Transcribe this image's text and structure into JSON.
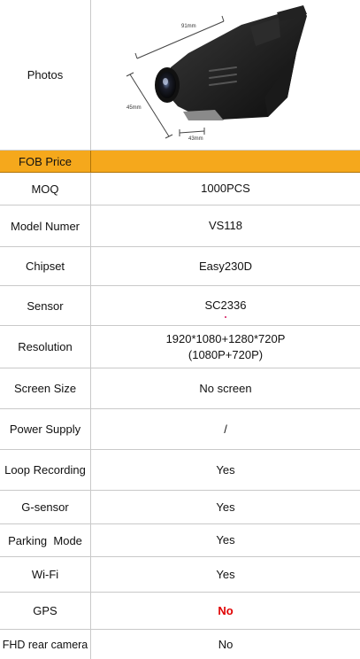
{
  "rows": [
    {
      "label": "Photos",
      "value": ""
    },
    {
      "label": "FOB Price",
      "value": ""
    },
    {
      "label": "MOQ",
      "value": "1000PCS"
    },
    {
      "label": "Model Numer",
      "value": "VS118"
    },
    {
      "label": "Chipset",
      "value": "Easy230D"
    },
    {
      "label": "Sensor",
      "value": "SC2336"
    },
    {
      "label": "Resolution",
      "value": "1920*1080+1280*720P",
      "value2": "(1080P+720P)"
    },
    {
      "label": "Screen Size",
      "value": "No screen"
    },
    {
      "label": "Power Supply",
      "value": "/"
    },
    {
      "label": "Loop Recording",
      "value": "Yes"
    },
    {
      "label": "G-sensor",
      "value": "Yes"
    },
    {
      "label": "Parking  Mode",
      "value": "Yes"
    },
    {
      "label": "Wi-Fi",
      "value": "Yes"
    },
    {
      "label": "GPS",
      "value": "No",
      "value_color": "#e00000"
    },
    {
      "label": "FHD rear camera",
      "value": "No"
    }
  ],
  "photo": {
    "dim_length": "91mm",
    "dim_height": "45mm",
    "dim_depth": "43mm"
  },
  "colors": {
    "fob_row": "#f5a81c",
    "gps_no": "#e00000",
    "grid": "#c9c9c9"
  }
}
